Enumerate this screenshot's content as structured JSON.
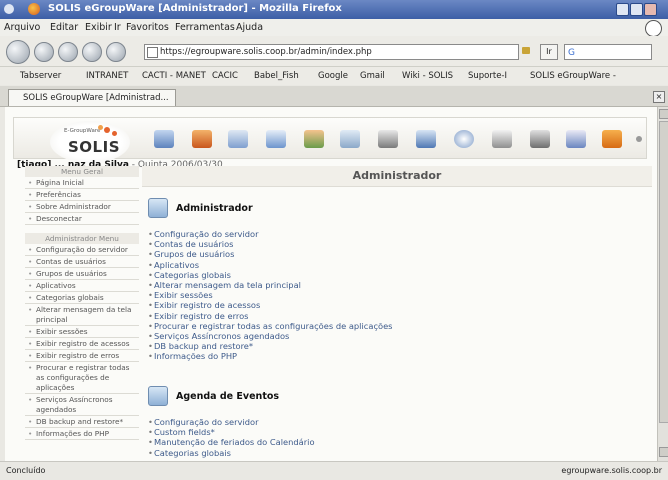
{
  "window": {
    "title": "SOLIS eGroupWare [Administrador] - Mozilla Firefox"
  },
  "menubar": [
    "Arquivo",
    "Editar",
    "Exibir",
    "Ir",
    "Favoritos",
    "Ferramentas",
    "Ajuda"
  ],
  "navbar": {
    "url": "https://egroupware.solis.coop.br/admin/index.php",
    "go_label": "Ir"
  },
  "bookmarks": [
    "Tabserver",
    "INTRANET",
    "CACTI - MANET",
    "CACIC",
    "Babel_Fish",
    "Google",
    "Gmail",
    "Wiki - SOLIS",
    "Suporte-I",
    "SOLIS eGroupWare -"
  ],
  "tab": {
    "label": "SOLIS eGroupWare [Administrad..."
  },
  "logo": {
    "small": "E-GroupWare",
    "big": "SOLIS"
  },
  "userline": {
    "name": "[tiago]",
    "rest": " ... naz da Silva",
    "date": " - Quinta 2006/03/30"
  },
  "sidebar": {
    "general_header": "Menu Geral",
    "general_items": [
      "Página Inicial",
      "Preferências",
      "Sobre Administrador",
      "Desconectar"
    ],
    "admin_header": "Administrador Menu",
    "admin_items": [
      "Configuração do servidor",
      "Contas de usuários",
      "Grupos de usuários",
      "Aplicativos",
      "Categorias globais",
      "Alterar mensagem da tela principal",
      "Exibir sessões",
      "Exibir registro de acessos",
      "Exibir registro de erros",
      "Procurar e registrar todas as configurações de aplicações",
      "Serviços Assíncronos agendados",
      "DB backup and restore*",
      "Informações do PHP"
    ]
  },
  "main": {
    "title": "Administrador",
    "section1": {
      "title": "Administrador",
      "links": [
        "Configuração do servidor",
        "Contas de usuários",
        "Grupos de usuários",
        "Aplicativos",
        "Categorias globais",
        "Alterar mensagem da tela principal",
        "Exibir sessões",
        "Exibir registro de acessos",
        "Exibir registro de erros",
        "Procurar e registrar todas as configurações de aplicações",
        "Serviços Assíncronos agendados",
        "DB backup and restore*",
        "Informações do PHP"
      ]
    },
    "section2": {
      "title": "Agenda de Eventos",
      "links": [
        "Configuração do servidor",
        "Custom fields*",
        "Manutenção de feriados do Calendário",
        "Categorias globais"
      ]
    }
  },
  "status": {
    "left": "Concluído",
    "right": "egroupware.solis.coop.br"
  },
  "colors": {
    "titlebar": "#3c5ea6",
    "link": "#3d5a8a",
    "accent_orange": "#e4632e"
  }
}
